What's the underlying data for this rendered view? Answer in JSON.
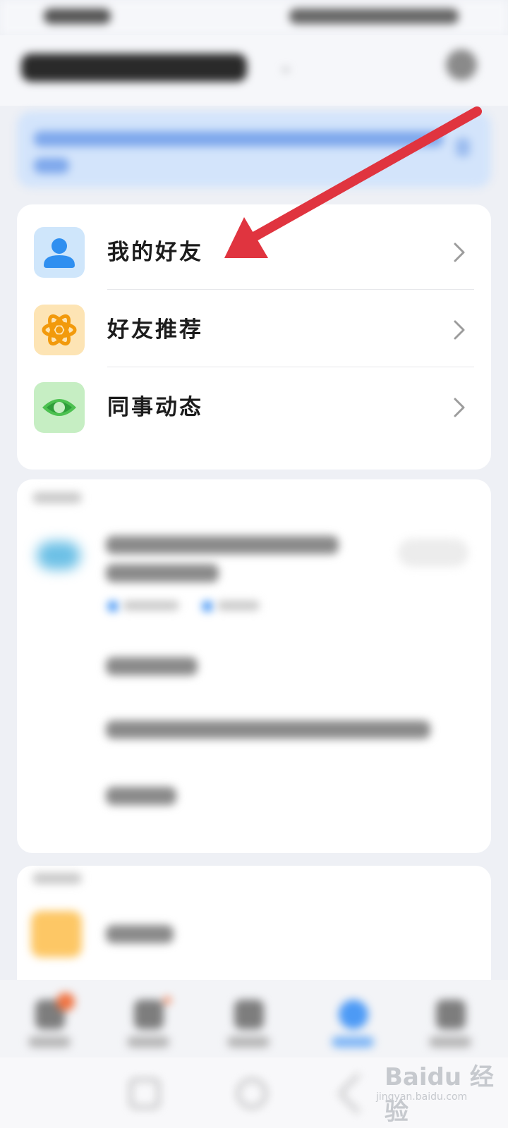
{
  "menu": {
    "items": [
      {
        "label": "我的好友",
        "icon": "contact-person-icon"
      },
      {
        "label": "好友推荐",
        "icon": "atom-recommend-icon"
      },
      {
        "label": "同事动态",
        "icon": "eye-moments-icon"
      }
    ]
  },
  "watermark": {
    "logo": "Baidu 经验",
    "url": "jingyan.baidu.com"
  },
  "colors": {
    "annotation_arrow": "#e0343f",
    "active_tab": "#4d9af5"
  }
}
